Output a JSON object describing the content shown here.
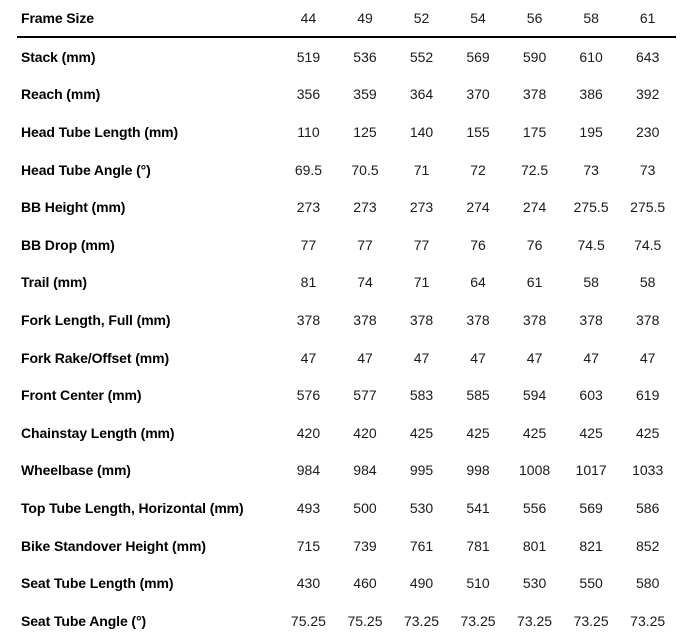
{
  "table": {
    "header": {
      "label": "Frame Size",
      "sizes": [
        "44",
        "49",
        "52",
        "54",
        "56",
        "58",
        "61"
      ]
    },
    "rows": [
      {
        "label": "Stack (mm)",
        "values": [
          "519",
          "536",
          "552",
          "569",
          "590",
          "610",
          "643"
        ]
      },
      {
        "label": "Reach (mm)",
        "values": [
          "356",
          "359",
          "364",
          "370",
          "378",
          "386",
          "392"
        ]
      },
      {
        "label": "Head Tube Length (mm)",
        "values": [
          "110",
          "125",
          "140",
          "155",
          "175",
          "195",
          "230"
        ]
      },
      {
        "label": "Head Tube Angle (°)",
        "values": [
          "69.5",
          "70.5",
          "71",
          "72",
          "72.5",
          "73",
          "73"
        ]
      },
      {
        "label": "BB Height (mm)",
        "values": [
          "273",
          "273",
          "273",
          "274",
          "274",
          "275.5",
          "275.5"
        ]
      },
      {
        "label": "BB Drop (mm)",
        "values": [
          "77",
          "77",
          "77",
          "76",
          "76",
          "74.5",
          "74.5"
        ]
      },
      {
        "label": "Trail (mm)",
        "values": [
          "81",
          "74",
          "71",
          "64",
          "61",
          "58",
          "58"
        ]
      },
      {
        "label": "Fork Length, Full (mm)",
        "values": [
          "378",
          "378",
          "378",
          "378",
          "378",
          "378",
          "378"
        ]
      },
      {
        "label": "Fork Rake/Offset (mm)",
        "values": [
          "47",
          "47",
          "47",
          "47",
          "47",
          "47",
          "47"
        ]
      },
      {
        "label": "Front Center (mm)",
        "values": [
          "576",
          "577",
          "583",
          "585",
          "594",
          "603",
          "619"
        ]
      },
      {
        "label": "Chainstay Length (mm)",
        "values": [
          "420",
          "420",
          "425",
          "425",
          "425",
          "425",
          "425"
        ]
      },
      {
        "label": "Wheelbase (mm)",
        "values": [
          "984",
          "984",
          "995",
          "998",
          "1008",
          "1017",
          "1033"
        ]
      },
      {
        "label": "Top Tube Length, Horizontal (mm)",
        "values": [
          "493",
          "500",
          "530",
          "541",
          "556",
          "569",
          "586"
        ]
      },
      {
        "label": "Bike Standover Height (mm)",
        "values": [
          "715",
          "739",
          "761",
          "781",
          "801",
          "821",
          "852"
        ]
      },
      {
        "label": "Seat Tube Length (mm)",
        "values": [
          "430",
          "460",
          "490",
          "510",
          "530",
          "550",
          "580"
        ]
      },
      {
        "label": "Seat Tube Angle (°)",
        "values": [
          "75.25",
          "75.25",
          "73.25",
          "73.25",
          "73.25",
          "73.25",
          "73.25"
        ]
      }
    ]
  },
  "style": {
    "text_color": "#000000",
    "value_color": "#1a1a1a",
    "rule_color": "#000000",
    "background": "#ffffff"
  }
}
